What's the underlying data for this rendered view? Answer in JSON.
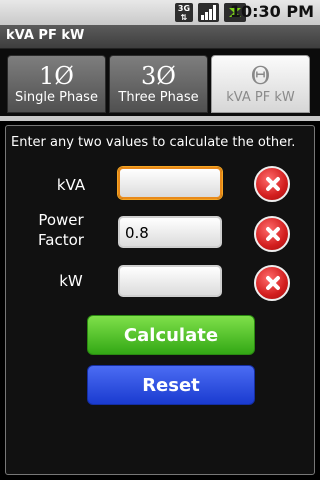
{
  "status_bar": {
    "network_type": "3G",
    "time": "10:30 PM",
    "icons": [
      "3g-data-icon",
      "signal-icon",
      "battery-charging-icon"
    ]
  },
  "title_bar": {
    "title": "kVA PF kW"
  },
  "tabs": [
    {
      "symbol": "1Ø",
      "label": "Single Phase",
      "active": false
    },
    {
      "symbol": "3Ø",
      "label": "Three Phase",
      "active": false
    },
    {
      "symbol": "Θ",
      "label": "kVA PF kW",
      "active": true
    }
  ],
  "form": {
    "instructions": "Enter any two values to calculate the other.",
    "fields": [
      {
        "label": "kVA",
        "value": ""
      },
      {
        "label": "Power Factor",
        "value": "0.8"
      },
      {
        "label": "kW",
        "value": ""
      }
    ],
    "calculate_label": "Calculate",
    "reset_label": "Reset"
  },
  "colors": {
    "focus_orange": "#e88a1a",
    "calculate_green": "#33a815",
    "reset_blue": "#1a3bd0",
    "clear_red": "#d21e1e"
  }
}
